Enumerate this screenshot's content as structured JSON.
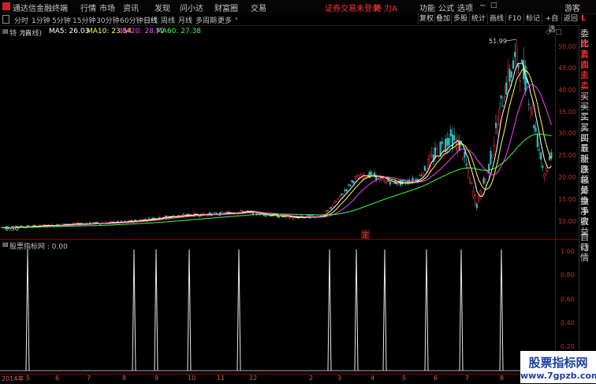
{
  "titlebar": {
    "app_name": "通达信金融终端",
    "menus": [
      "行情",
      "市场",
      "资讯",
      "发现",
      "问小达",
      "财富圈",
      "交易"
    ],
    "notice": "证券交易未登录",
    "stock_name": "特 力A",
    "right_menus": [
      "功能",
      "公式",
      "选项"
    ],
    "user": "游客"
  },
  "period_bar": {
    "periods": [
      "分时",
      "1分钟",
      "5分钟",
      "15分钟",
      "30分钟",
      "60分钟",
      "日线",
      "周线",
      "月线",
      "多周期",
      "更多"
    ],
    "active": "日线"
  },
  "toolbar_right": [
    "复权",
    "叠加",
    "多股",
    "统计",
    "画线",
    "F10",
    "标记",
    "+自选",
    "返回"
  ],
  "main_chart": {
    "stock_label": "特 力A",
    "period_label": "(日线)",
    "ma_labels": [
      {
        "text": "MA5: 26.03",
        "color": "#ffffff"
      },
      {
        "text": "MA10: 23.54",
        "color": "#ffff40"
      },
      {
        "text": "MA20: 28.72",
        "color": "#ff40ff"
      },
      {
        "text": "MA60: 27.38",
        "color": "#40ff40"
      }
    ],
    "high_label": "51.99",
    "low_label": "6.50",
    "marker": "定",
    "y_ticks": [
      "50.00",
      "45.00",
      "40.00",
      "35.00",
      "30.00",
      "25.00",
      "20.00",
      "15.00",
      "10.00"
    ]
  },
  "indicator": {
    "label": "股票指标网 : 0.00",
    "y_ticks": [
      "1.00",
      "0.80",
      "0.60",
      "0.40",
      "0.20"
    ],
    "signals": [
      5,
      9,
      10,
      12,
      1,
      3,
      4,
      5,
      7,
      8
    ]
  },
  "x_axis": [
    "2014年",
    "5",
    "6",
    "7",
    "8",
    "9",
    "10",
    "11",
    "12",
    "2",
    "3",
    "4",
    "5",
    "6",
    "7",
    "8"
  ],
  "side_panel": [
    "委比",
    "卖五",
    "卖四",
    "卖三",
    "卖二",
    "卖一",
    "买一",
    "买二",
    "买三",
    "买四",
    "买五",
    "最新",
    "涨跌",
    "涨幅",
    "总量",
    "外盘",
    "换手",
    "净资",
    "收益",
    "自动",
    "行情"
  ],
  "side_top": "L",
  "watermark": {
    "line1": "股票指标网",
    "line2": "www.7gpzb.com"
  },
  "colors": {
    "up": "#ff3030",
    "down": "#30c0c0",
    "ma5": "#ffffff",
    "ma10": "#ffff40",
    "ma20": "#ff40ff",
    "ma60": "#40ff40"
  }
}
